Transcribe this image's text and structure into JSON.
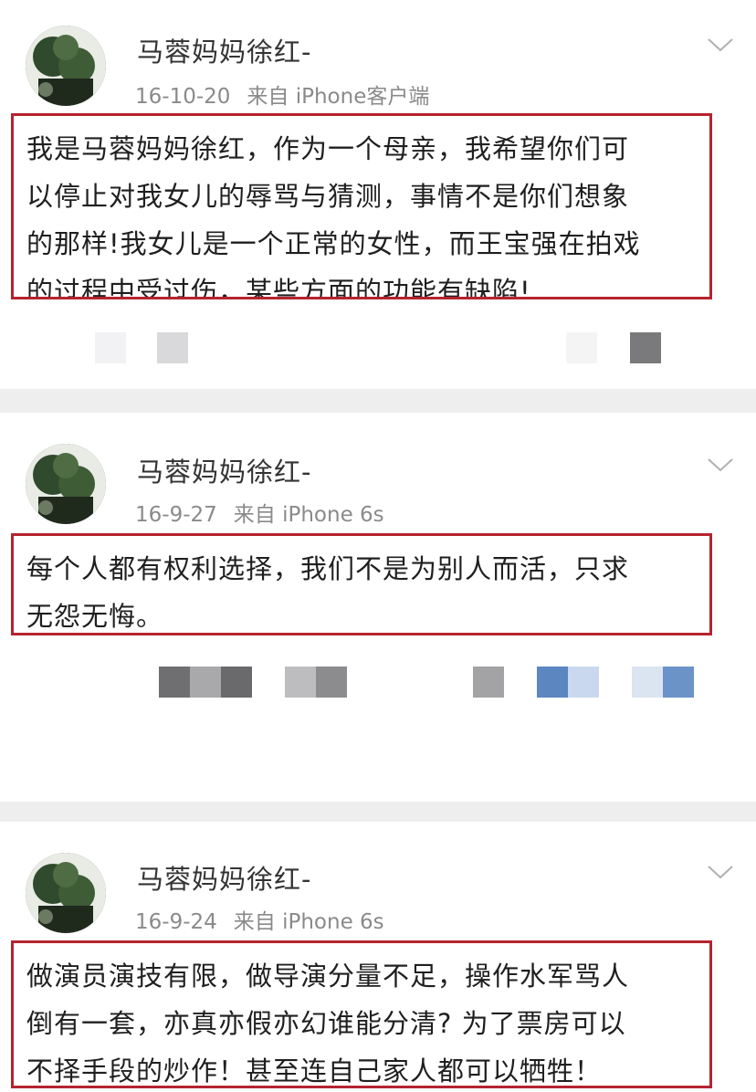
{
  "posts": [
    {
      "username": "马蓉妈妈徐红-",
      "date": "16-10-20",
      "source_prefix": "来自",
      "source": "iPhone客户端",
      "lines": [
        "我是马蓉妈妈徐红，作为一个母亲，我希望你们可",
        "以停止对我女儿的辱骂与猜测，事情不是你们想象",
        "的那样!我女儿是一个正常的女性，而王宝强在拍戏",
        "的过程中受过伤，某些方面的功能有缺陷!"
      ],
      "menu_icon": "chevron-down-icon"
    },
    {
      "username": "马蓉妈妈徐红-",
      "date": "16-9-27",
      "source_prefix": "来自",
      "source": "iPhone 6s",
      "lines": [
        "每个人都有权利选择，我们不是为别人而活，只求",
        "无怨无悔。"
      ],
      "menu_icon": "chevron-down-icon"
    },
    {
      "username": "马蓉妈妈徐红-",
      "date": "16-9-24",
      "source_prefix": "来自",
      "source": "iPhone 6s",
      "lines": [
        "做演员演技有限，做导演分量不足，操作水军骂人",
        "倒有一套，亦真亦假亦幻谁能分清? 为了票房可以",
        "不择手段的炒作！甚至连自己家人都可以牺牲！"
      ],
      "menu_icon": "chevron-down-icon"
    }
  ],
  "colors": {
    "highlight_border": "#b5242f",
    "separator": "#eeeeef",
    "username": "#333333",
    "meta": "#8a8a8a"
  }
}
